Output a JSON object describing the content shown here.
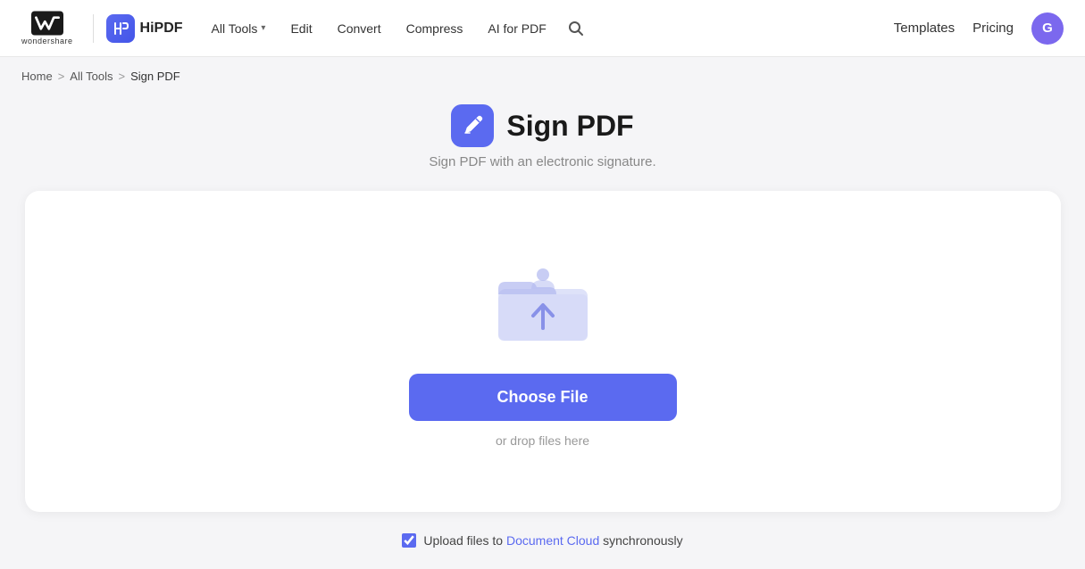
{
  "header": {
    "wondershare_text": "wondershare",
    "hipdf_label": "HiPDF",
    "nav": {
      "all_tools": "All Tools",
      "edit": "Edit",
      "convert": "Convert",
      "compress": "Compress",
      "ai_for_pdf": "AI for PDF"
    },
    "nav_right": {
      "templates": "Templates",
      "pricing": "Pricing",
      "avatar_letter": "G"
    }
  },
  "breadcrumb": {
    "home": "Home",
    "separator1": ">",
    "all_tools": "All Tools",
    "separator2": ">",
    "current": "Sign PDF"
  },
  "page": {
    "title": "Sign PDF",
    "subtitle": "Sign PDF with an electronic signature.",
    "choose_file_label": "Choose File",
    "drop_text": "or drop files here",
    "checkbox_prefix": "Upload files to",
    "cloud_link_text": "Document Cloud",
    "checkbox_suffix": "synchronously"
  },
  "icons": {
    "search": "🔍",
    "page_icon_letter": "✍"
  }
}
